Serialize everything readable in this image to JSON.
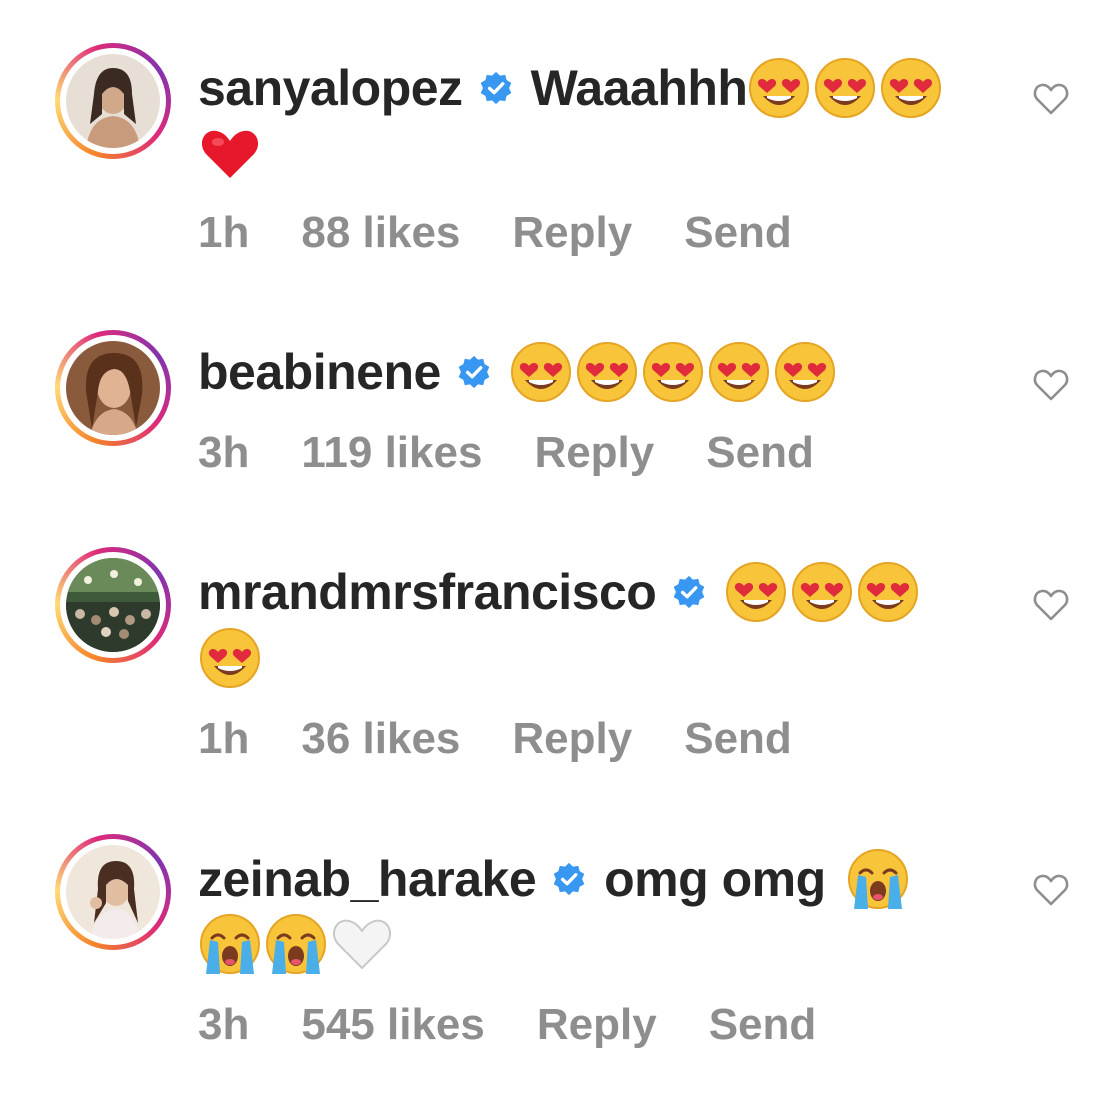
{
  "comments": [
    {
      "username": "sanyalopez",
      "text": "Waaahhh",
      "inline_emojis": [
        "heart-eyes",
        "heart-eyes",
        "heart-eyes"
      ],
      "wrap_emojis": [
        "red-heart"
      ],
      "time": "1h",
      "likes": "88 likes",
      "reply": "Reply",
      "send": "Send"
    },
    {
      "username": "beabinene",
      "text": "",
      "inline_emojis": [
        "heart-eyes",
        "heart-eyes",
        "heart-eyes",
        "heart-eyes",
        "heart-eyes"
      ],
      "wrap_emojis": [],
      "time": "3h",
      "likes": "119 likes",
      "reply": "Reply",
      "send": "Send"
    },
    {
      "username": "mrandmrsfrancisco",
      "text": "",
      "inline_emojis": [
        "heart-eyes",
        "heart-eyes",
        "heart-eyes"
      ],
      "wrap_emojis": [
        "heart-eyes"
      ],
      "time": "1h",
      "likes": "36 likes",
      "reply": "Reply",
      "send": "Send"
    },
    {
      "username": "zeinab_harake",
      "text": "omg omg",
      "inline_emojis": [
        "loudly-crying"
      ],
      "wrap_emojis": [
        "loudly-crying",
        "loudly-crying",
        "white-heart"
      ],
      "time": "3h",
      "likes": "545 likes",
      "reply": "Reply",
      "send": "Send"
    }
  ],
  "colors": {
    "text": "#262626",
    "meta": "#8e8e8e",
    "verified": "#3897f0",
    "ring_start": "#f58529",
    "ring_end": "#8134af"
  }
}
